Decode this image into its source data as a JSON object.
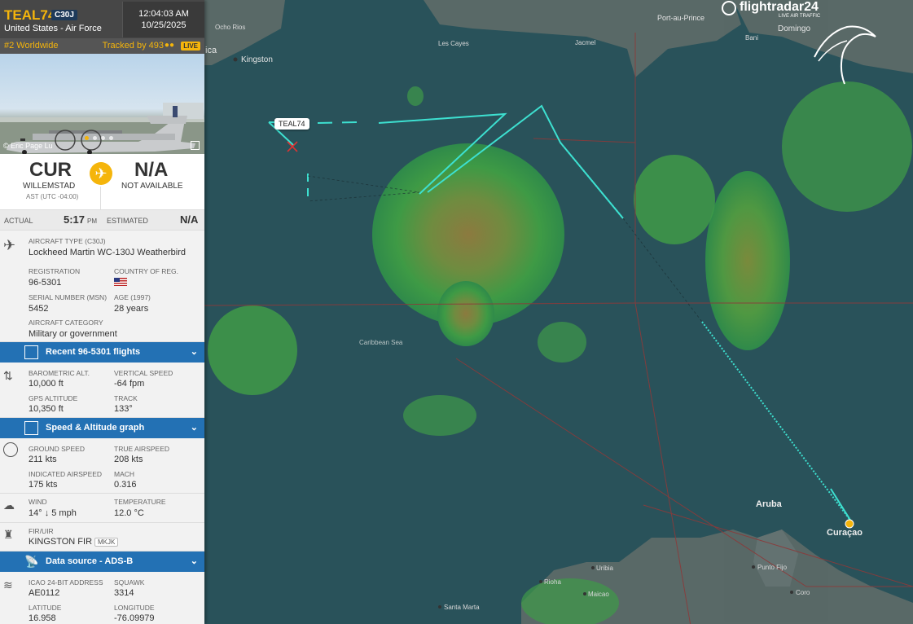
{
  "flight": {
    "callsign": "TEAL74",
    "type_badge": "C30J",
    "airline": "United States - Air Force",
    "time": "12:04:03 AM",
    "date": "10/25/2025",
    "rank": "#2 Worldwide",
    "tracked": "Tracked by 493",
    "live": "LIVE",
    "photo_credit": "© Eric Page Lu"
  },
  "route": {
    "origin_code": "CUR",
    "origin_city": "WILLEMSTAD",
    "origin_tz": "AST (UTC -04:00)",
    "dest_code": "N/A",
    "dest_city": "NOT AVAILABLE",
    "actual_label": "ACTUAL",
    "actual_time": "5:17",
    "actual_ampm": "PM",
    "estimated_label": "ESTIMATED",
    "estimated_time": "N/A"
  },
  "aircraft": {
    "type_label": "AIRCRAFT TYPE (C30J)",
    "type_value": "Lockheed Martin WC-130J Weatherbird",
    "reg_label": "REGISTRATION",
    "reg_value": "96-5301",
    "country_label": "COUNTRY OF REG.",
    "serial_label": "SERIAL NUMBER (MSN)",
    "serial_value": "5452",
    "age_label": "AGE (1997)",
    "age_value": "28 years",
    "category_label": "AIRCRAFT CATEGORY",
    "category_value": "Military or government"
  },
  "bars": {
    "recent": "Recent 96-5301 flights",
    "graph": "Speed & Altitude graph",
    "source": "Data source - ADS-B"
  },
  "altitude": {
    "baro_label": "BAROMETRIC ALT.",
    "baro_value": "10,000 ft",
    "vs_label": "VERTICAL SPEED",
    "vs_value": "-64 fpm",
    "gps_label": "GPS ALTITUDE",
    "gps_value": "10,350 ft",
    "track_label": "TRACK",
    "track_value": "133°"
  },
  "speed": {
    "gs_label": "GROUND SPEED",
    "gs_value": "211 kts",
    "tas_label": "TRUE AIRSPEED",
    "tas_value": "208 kts",
    "ias_label": "INDICATED AIRSPEED",
    "ias_value": "175 kts",
    "mach_label": "MACH",
    "mach_value": "0.316"
  },
  "weather": {
    "wind_label": "WIND",
    "wind_value": "14° ↓ 5 mph",
    "temp_label": "TEMPERATURE",
    "temp_value": "12.0 °C"
  },
  "fir": {
    "label": "FIR/UIR",
    "value": "KINGSTON FIR",
    "code": "MKJK"
  },
  "source": {
    "icao_label": "ICAO 24-BIT ADDRESS",
    "icao_value": "AE0112",
    "squawk_label": "SQUAWK",
    "squawk_value": "3314",
    "lat_label": "LATITUDE",
    "lat_value": "16.958",
    "lon_label": "LONGITUDE",
    "lon_value": "-76.09979"
  },
  "map": {
    "brand": "flightradar24",
    "brand_sub": "LIVE AIR TRAFFIC",
    "aircraft_tag": "TEAL74",
    "places": {
      "port_au_prince": "Port-au-Prince",
      "domingo": "Domingo",
      "kingston": "Kingston",
      "les_cayes": "Les Cayes",
      "jacmel": "Jacmel",
      "bani": "Bani",
      "ocho_rios": "Ocho Rios",
      "ica": "ica",
      "caribbean_sea": "Caribbean Sea",
      "aruba": "Aruba",
      "curacao": "Curaçao",
      "punto_fijo": "Punto Fijo",
      "uribia": "Uribia",
      "riohacha": "Rioha",
      "maicao": "Maicao",
      "coro": "Coro",
      "santa_marta": "Santa Marta"
    }
  }
}
